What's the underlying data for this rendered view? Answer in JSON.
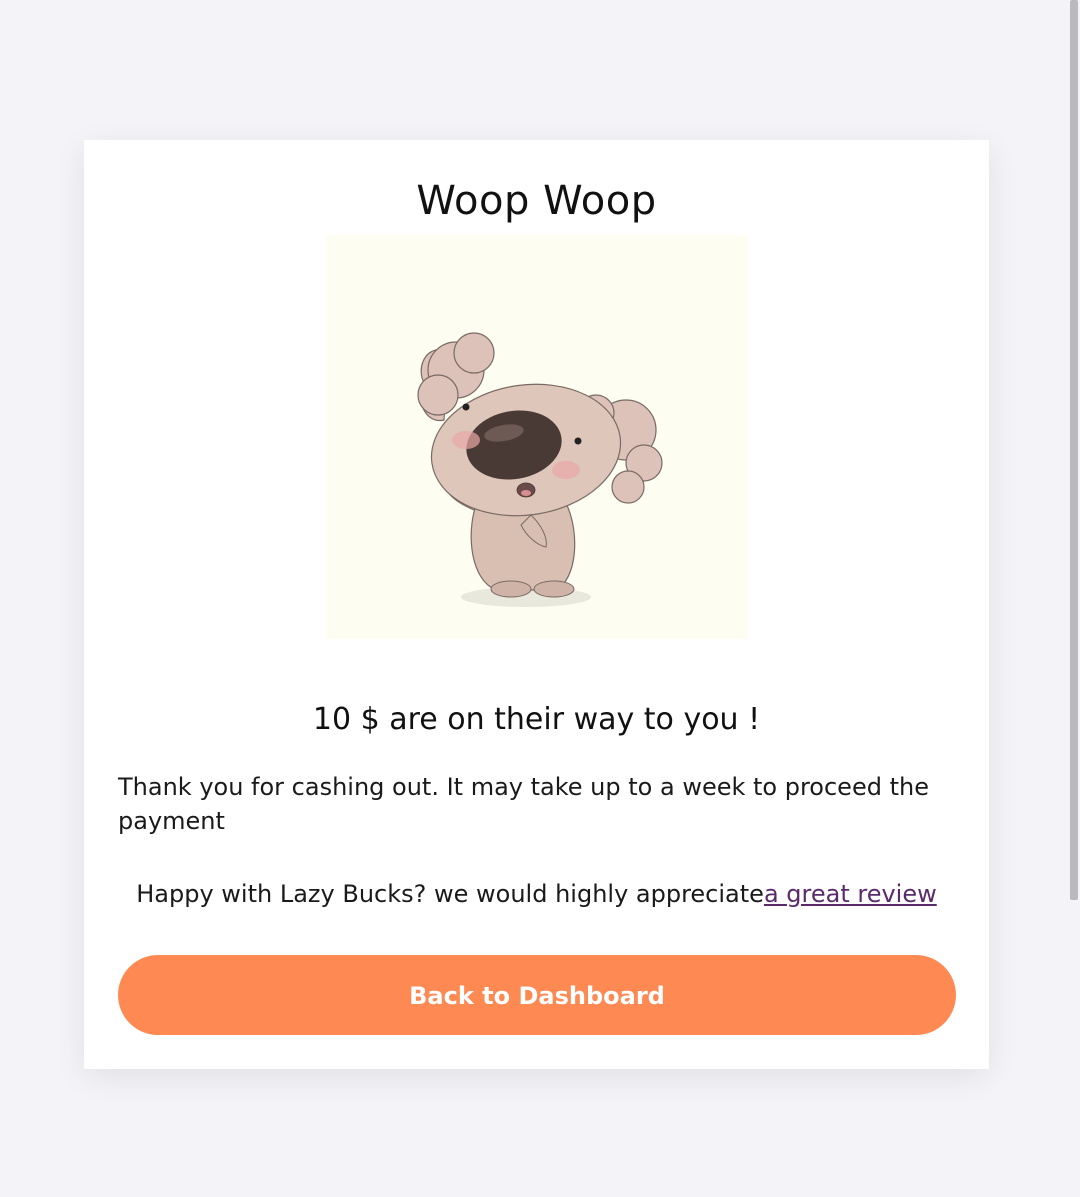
{
  "card": {
    "title": "Woop Woop",
    "amount_text": "10 $ are on their way to you !",
    "message": "Thank you for cashing out. It may take up to a week to proceed the payment",
    "review_prefix": "Happy with Lazy Bucks? we would highly appreciate",
    "review_link": "a great review",
    "button_label": "Back to Dashboard"
  },
  "colors": {
    "accent": "#ff8952",
    "link": "#5a2a6d",
    "page_background": "#f4f4f8"
  },
  "illustration": {
    "icon": "cheering-koala-illustration"
  }
}
